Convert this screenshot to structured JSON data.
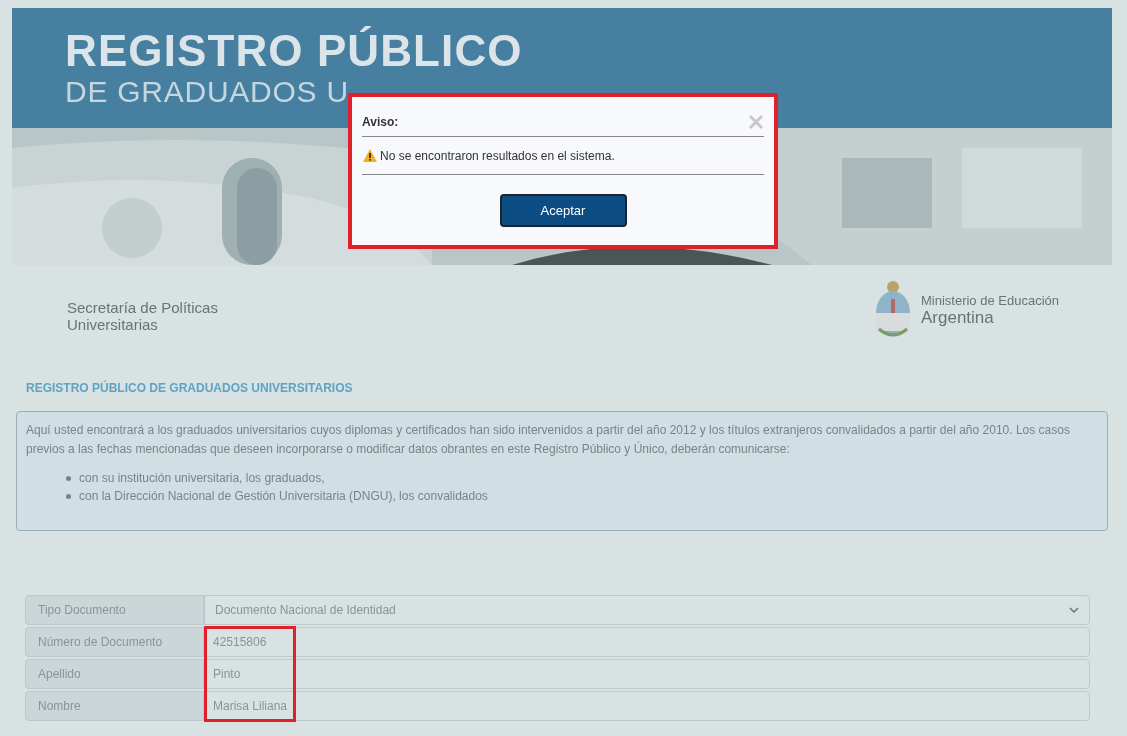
{
  "banner": {
    "title": "REGISTRO PÚBLICO",
    "subtitle": "DE GRADUADOS U"
  },
  "logos": {
    "left_line1": "Secretaría de Políticas",
    "left_line2": "Universitarias",
    "right_line1": "Ministerio de Educación",
    "right_line2": "Argentina"
  },
  "heading": "REGISTRO PÚBLICO DE GRADUADOS UNIVERSITARIOS",
  "info": {
    "paragraph": "Aquí usted encontrará a los graduados universitarios cuyos diplomas y certificados han sido intervenidos a partir del año 2012 y los títulos extranjeros convalidados a partir del año 2010. Los casos previos a las fechas mencionadas que deseen incorporarse o modificar datos obrantes en este Registro Público y Único, deberán comunicarse:",
    "bullets": [
      "con su institución universitaria, los graduados,",
      "con la Dirección Nacional de Gestión Universitaria (DNGU), los convalidados"
    ]
  },
  "form": [
    {
      "label": "Tipo Documento",
      "value": "Documento Nacional de Identidad",
      "kind": "select",
      "highlighted": false
    },
    {
      "label": "Número de Documento",
      "value": "42515806",
      "kind": "input",
      "highlighted": true
    },
    {
      "label": "Apellido",
      "value": "Pinto",
      "kind": "input",
      "highlighted": true
    },
    {
      "label": "Nombre",
      "value": "Marisa Liliana",
      "kind": "input",
      "highlighted": true
    }
  ],
  "dialog": {
    "title": "Aviso:",
    "message": "No se encontraron resultados en el sistema.",
    "button": "Aceptar",
    "highlighted": true
  }
}
